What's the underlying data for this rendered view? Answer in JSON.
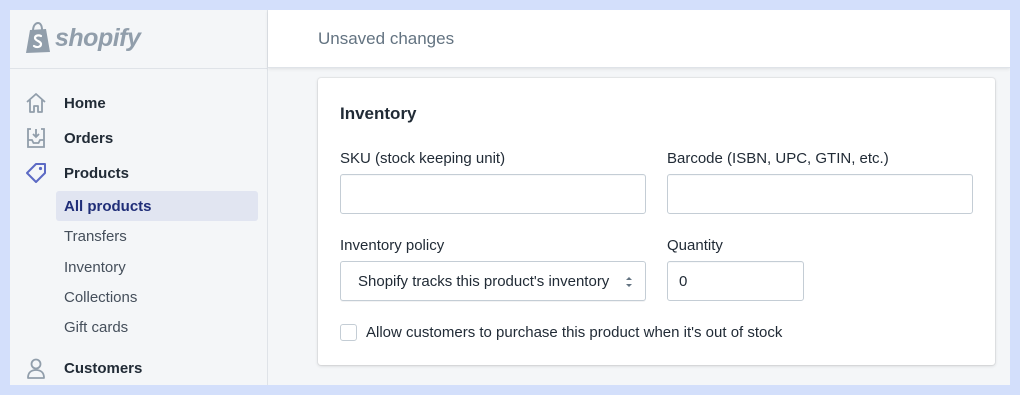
{
  "brand": {
    "name": "shopify",
    "icon": "shopify-bag-icon"
  },
  "topbar": {
    "title": "Unsaved changes"
  },
  "sidebar": {
    "items": [
      {
        "label": "Home",
        "icon": "home-icon"
      },
      {
        "label": "Orders",
        "icon": "orders-inbox-icon"
      },
      {
        "label": "Products",
        "icon": "tag-icon"
      },
      {
        "label": "Customers",
        "icon": "person-icon"
      }
    ],
    "product_subitems": [
      {
        "label": "All products",
        "active": true
      },
      {
        "label": "Transfers"
      },
      {
        "label": "Inventory"
      },
      {
        "label": "Collections"
      },
      {
        "label": "Gift cards"
      }
    ]
  },
  "inventory_card": {
    "title": "Inventory",
    "sku": {
      "label": "SKU (stock keeping unit)",
      "value": ""
    },
    "barcode": {
      "label": "Barcode (ISBN, UPC, GTIN, etc.)",
      "value": ""
    },
    "policy": {
      "label": "Inventory policy",
      "value": "Shopify tracks this product's inventory"
    },
    "quantity": {
      "label": "Quantity",
      "value": "0"
    },
    "oversell_checkbox": {
      "label": "Allow customers to purchase this product when it's out of stock",
      "checked": false
    }
  },
  "colors": {
    "page_background": "#d3dffb",
    "sidebar_active_background": "#e1e5f1",
    "sidebar_active_text": "#202e78",
    "icon_gray": "#919eab",
    "products_tag_icon": "#5c6ac4"
  }
}
